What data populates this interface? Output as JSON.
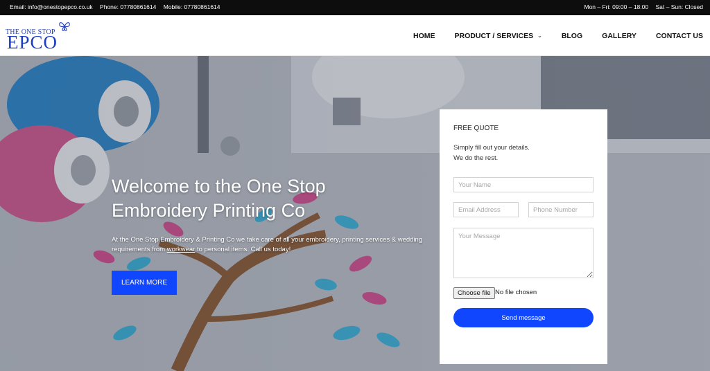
{
  "topbar": {
    "email": "Email: info@onestopepco.co.uk",
    "phone": "Phone: 07780861614",
    "mobile": "Mobile: 07780861614",
    "hours_week": "Mon – Fri: 09:00 – 18:00",
    "hours_weekend": "Sat – Sun: Closed"
  },
  "logo": {
    "tagline": "THE ONE STOP",
    "wordmark": "EPCO",
    "icon": "butterfly-icon"
  },
  "nav": {
    "items": [
      {
        "label": "HOME"
      },
      {
        "label": "PRODUCT / SERVICES",
        "icon": "chevron-down-icon"
      },
      {
        "label": "BLOG"
      },
      {
        "label": "GALLERY"
      },
      {
        "label": "CONTACT US"
      }
    ]
  },
  "hero": {
    "title": "Welcome to the One Stop Embroidery Printing Co",
    "text_before": "At the One Stop Embroidery & Printing Co we take care of all your embroidery, printing services & wedding requirements from ",
    "text_link": "workwear",
    "text_after": " to personal items. Call us today!",
    "button": "LEARN MORE"
  },
  "quote_form": {
    "title": "FREE QUOTE",
    "desc_line1": "Simply fill out your details.",
    "desc_line2": "We do the rest.",
    "name_placeholder": "Your Name",
    "email_placeholder": "Email Address",
    "phone_placeholder": "Phone Number",
    "message_placeholder": "Your Message",
    "file_button": "Choose file",
    "file_status": "No file chosen",
    "submit": "Send message"
  },
  "colors": {
    "accent": "#1146ff",
    "topbar": "#0d0d0d",
    "logo": "#1d3fbf"
  }
}
